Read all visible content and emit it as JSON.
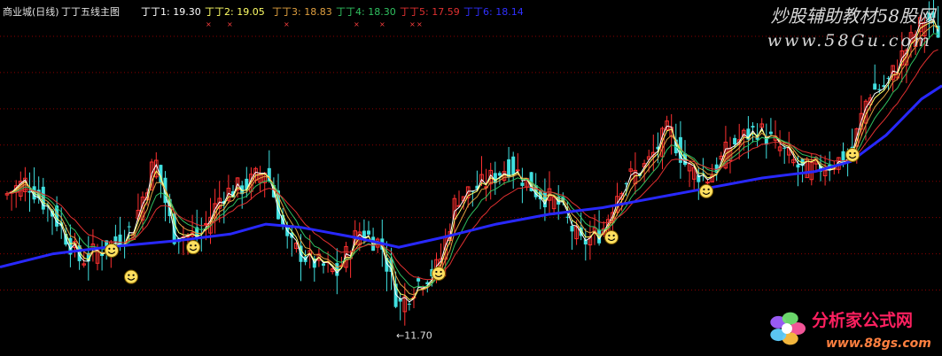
{
  "chart_data": {
    "type": "candlestick",
    "header": {
      "stock": "商业城(日线)",
      "indicator": "丁丁五线主图",
      "lines": [
        {
          "label": "丁丁1:",
          "value": "19.30",
          "color": "#ffffff"
        },
        {
          "label": "丁丁2:",
          "value": "19.05",
          "color": "#ffff66"
        },
        {
          "label": "丁丁3:",
          "value": "18.83",
          "color": "#e0a040"
        },
        {
          "label": "丁丁4:",
          "value": "18.30",
          "color": "#30c060"
        },
        {
          "label": "丁丁5:",
          "value": "17.59",
          "color": "#e03030"
        },
        {
          "label": "丁丁6:",
          "value": "18.14",
          "color": "#3030ff"
        }
      ]
    },
    "y_range": [
      10.8,
      21.6
    ],
    "low_annotation": {
      "text": "←11.70",
      "value": 11.7
    },
    "colors": {
      "up": "#ff3030",
      "down": "#40e0e0",
      "grid": "#8b0000",
      "ma6": "#2828ff",
      "smiley": "#ffe060"
    },
    "grid_levels": [
      20.5,
      19.4,
      18.3,
      17.2,
      16.1,
      15.0,
      13.9,
      12.8
    ],
    "ma6": [
      [
        0,
        13.5
      ],
      [
        60,
        13.9
      ],
      [
        120,
        14.1
      ],
      [
        200,
        14.3
      ],
      [
        260,
        14.5
      ],
      [
        300,
        14.8
      ],
      [
        340,
        14.7
      ],
      [
        400,
        14.4
      ],
      [
        450,
        14.1
      ],
      [
        500,
        14.4
      ],
      [
        560,
        14.8
      ],
      [
        620,
        15.1
      ],
      [
        680,
        15.3
      ],
      [
        740,
        15.6
      ],
      [
        800,
        15.9
      ],
      [
        860,
        16.2
      ],
      [
        920,
        16.4
      ],
      [
        960,
        16.7
      ],
      [
        1000,
        17.5
      ],
      [
        1040,
        18.6
      ],
      [
        1063,
        19.0
      ]
    ],
    "smileys": [
      [
        126,
        14.0
      ],
      [
        148,
        13.2
      ],
      [
        218,
        14.1
      ],
      [
        495,
        13.3
      ],
      [
        690,
        14.4
      ],
      [
        797,
        15.8
      ],
      [
        962,
        16.9
      ]
    ],
    "price_path": [
      [
        0,
        15.6
      ],
      [
        30,
        16.1
      ],
      [
        60,
        15.1
      ],
      [
        90,
        13.7
      ],
      [
        120,
        14.1
      ],
      [
        150,
        14.7
      ],
      [
        175,
        16.8
      ],
      [
        195,
        14.5
      ],
      [
        225,
        14.4
      ],
      [
        250,
        15.7
      ],
      [
        280,
        16.0
      ],
      [
        300,
        16.5
      ],
      [
        325,
        14.2
      ],
      [
        350,
        13.7
      ],
      [
        380,
        13.3
      ],
      [
        405,
        14.6
      ],
      [
        430,
        14.2
      ],
      [
        450,
        12.3
      ],
      [
        470,
        13.0
      ],
      [
        495,
        13.5
      ],
      [
        515,
        15.6
      ],
      [
        545,
        16.0
      ],
      [
        575,
        16.6
      ],
      [
        605,
        15.8
      ],
      [
        630,
        15.4
      ],
      [
        655,
        14.2
      ],
      [
        680,
        14.6
      ],
      [
        700,
        16.0
      ],
      [
        730,
        16.6
      ],
      [
        755,
        17.7
      ],
      [
        775,
        16.5
      ],
      [
        800,
        16.2
      ],
      [
        825,
        17.2
      ],
      [
        855,
        17.7
      ],
      [
        880,
        17.1
      ],
      [
        905,
        16.4
      ],
      [
        935,
        16.6
      ],
      [
        960,
        16.9
      ],
      [
        980,
        18.8
      ],
      [
        1000,
        19.0
      ],
      [
        1020,
        20.0
      ],
      [
        1045,
        21.1
      ],
      [
        1063,
        20.5
      ]
    ],
    "labels": {
      "watermark_top_1": "炒股辅助教材58股网",
      "watermark_top_2": "www.58Gu.com",
      "watermark_bot_1": "分析家公式网",
      "watermark_bot_2": "www.88gs.com"
    }
  }
}
